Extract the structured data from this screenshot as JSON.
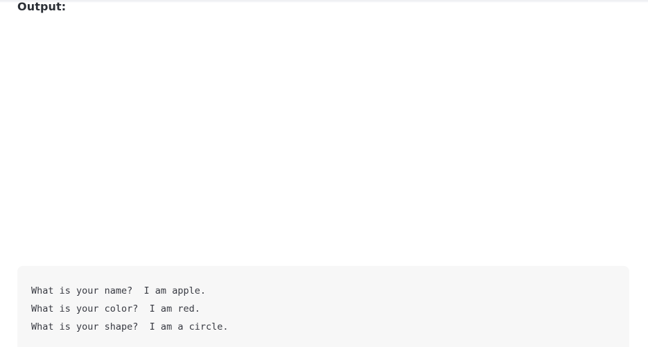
{
  "heading": "Output:",
  "output_lines": [
    "What is your name?  I am apple.",
    "What is your color?  I am red.",
    "What is your shape?  I am a circle."
  ]
}
